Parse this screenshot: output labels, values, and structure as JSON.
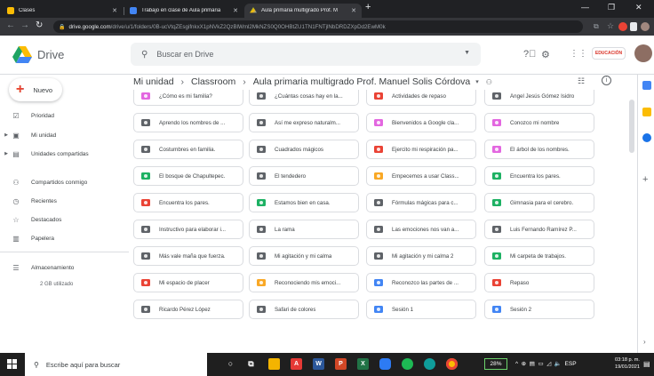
{
  "browser": {
    "tabs": [
      {
        "title": "Clases",
        "color": "#fbbc04",
        "active": false
      },
      {
        "title": "Trabajo en clase de Aula primaria",
        "color": "#4285f4",
        "active": false
      },
      {
        "title": "Aula primaria multigrado Prof. M",
        "color": "#34a853",
        "active": true
      }
    ],
    "new_tab": "+",
    "url_host": "drive.google.com",
    "url_path": "/drive/u/1/folders/0B-ucVtqZEsgifnkxX1pNVkZ2QzBlWml2MkNZS0Q0OHBtZU1TN1FNTjlNbDRDZXpDd2EwM0k"
  },
  "drive": {
    "app_name": "Drive",
    "search_placeholder": "Buscar en Drive",
    "badge": "EDUCACIÓN"
  },
  "sidebar": {
    "new_label": "Nuevo",
    "items": [
      {
        "label": "Prioridad",
        "icon": "☑"
      },
      {
        "label": "Mi unidad",
        "icon": "▣"
      },
      {
        "label": "Unidades compartidas",
        "icon": "▤"
      },
      {
        "label": "Compartidos conmigo",
        "icon": "👥"
      },
      {
        "label": "Recientes",
        "icon": "◷"
      },
      {
        "label": "Destacados",
        "icon": "☆"
      },
      {
        "label": "Papelera",
        "icon": "🗑"
      },
      {
        "label": "Almacenamiento",
        "icon": "☰"
      }
    ],
    "storage_used": "2 GB utilizado"
  },
  "breadcrumb": {
    "items": [
      "Mi unidad",
      "Classroom",
      "Aula primaria multigrado Prof. Manuel Solis Córdova"
    ]
  },
  "colors": {
    "dark": "#5f6368",
    "pink": "#e367e0",
    "red": "#ea4335",
    "green": "#1db163",
    "orange": "#f9a825",
    "blue": "#4285f4"
  },
  "folders": [
    {
      "name": "¿Cómo es mi familia?",
      "color": "pink"
    },
    {
      "name": "¿Cuántas cosas hay en la...",
      "color": "dark"
    },
    {
      "name": "Actividades de repaso",
      "color": "red"
    },
    {
      "name": "Ángel Jesús Gómez Isidro",
      "color": "dark"
    },
    {
      "name": "Aprendo los nombres de ...",
      "color": "dark"
    },
    {
      "name": "Así me expreso naturalm...",
      "color": "dark"
    },
    {
      "name": "Bienvenidos a Google cla...",
      "color": "pink"
    },
    {
      "name": "Conozco mi nombre",
      "color": "pink"
    },
    {
      "name": "Costumbres en familia.",
      "color": "dark"
    },
    {
      "name": "Cuadrados mágicos",
      "color": "dark"
    },
    {
      "name": "Ejercito mi respiración pa...",
      "color": "red"
    },
    {
      "name": "El árbol de los nombres.",
      "color": "pink"
    },
    {
      "name": "El bosque de Chapultepec.",
      "color": "green"
    },
    {
      "name": "El tendedero",
      "color": "dark"
    },
    {
      "name": "Empecemos a usar Class...",
      "color": "orange"
    },
    {
      "name": "Encuentra los pares.",
      "color": "green"
    },
    {
      "name": "Encuentra los pares.",
      "color": "red"
    },
    {
      "name": "Estamos bien en casa.",
      "color": "green"
    },
    {
      "name": "Fórmulas mágicas para c...",
      "color": "dark"
    },
    {
      "name": "Gimnasia para el cerebro.",
      "color": "green"
    },
    {
      "name": "Instructivo para elaborar i...",
      "color": "dark"
    },
    {
      "name": "La rama",
      "color": "dark"
    },
    {
      "name": "Las emociones nos van a...",
      "color": "dark"
    },
    {
      "name": "Luis Fernando Ramírez P...",
      "color": "dark"
    },
    {
      "name": "Más vale maña que fuerza.",
      "color": "dark"
    },
    {
      "name": "Mi agitación y mi calma",
      "color": "dark"
    },
    {
      "name": "Mi agitación y mi calma 2",
      "color": "dark"
    },
    {
      "name": "Mi carpeta de trabajos.",
      "color": "green"
    },
    {
      "name": "Mi espacio de placer",
      "color": "red"
    },
    {
      "name": "Reconociendo mis emoci...",
      "color": "orange"
    },
    {
      "name": "Reconozco las partes de ...",
      "color": "blue"
    },
    {
      "name": "Repaso",
      "color": "red"
    },
    {
      "name": "Ricardo Pérez López",
      "color": "dark"
    },
    {
      "name": "Safari de colores",
      "color": "dark"
    },
    {
      "name": "Sesión 1",
      "color": "blue"
    },
    {
      "name": "Sesión 2",
      "color": "blue"
    }
  ],
  "taskbar": {
    "search_placeholder": "Escribe aquí para buscar",
    "battery": "28%",
    "lang": "ESP",
    "time": "03:18 p. m.",
    "date": "19/01/2021"
  }
}
